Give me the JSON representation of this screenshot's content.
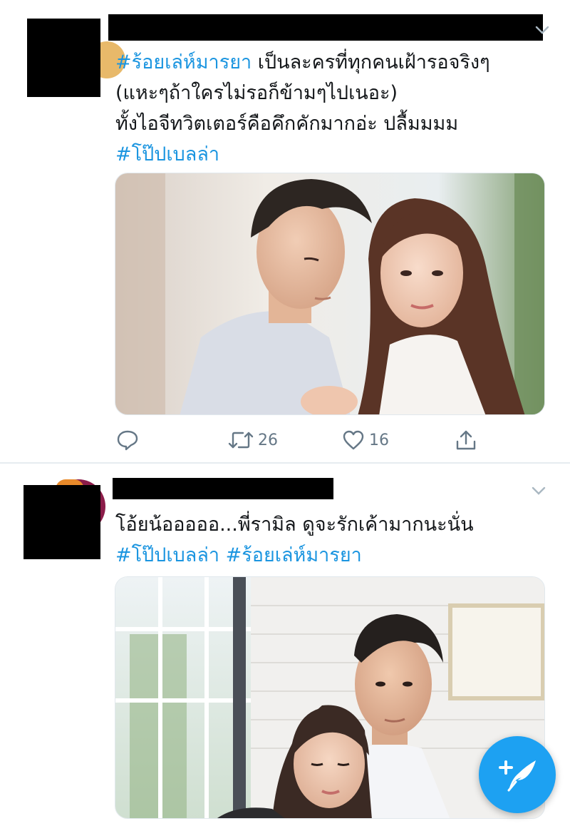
{
  "tweets": [
    {
      "text_lines": [
        [
          {
            "t": "#ร้อยเล่ห์มารยา",
            "tag": true
          },
          {
            "t": " เป็นละครที่ทุกคนเฝ้ารอจริงๆ",
            "tag": false
          }
        ],
        [
          {
            "t": "(แหะๆถ้าใครไม่รอก็ข้ามๆไปเนอะ)",
            "tag": false
          }
        ],
        [
          {
            "t": "ทั้งไอจีทวิตเตอร์คือคึกคักมากอ่ะ ปลื้มมมม",
            "tag": false
          }
        ],
        [
          {
            "t": "#โป๊ปเบลล่า",
            "tag": true
          }
        ]
      ],
      "actions": {
        "reply_count": "",
        "retweet_count": "26",
        "like_count": "16"
      }
    },
    {
      "text_lines": [
        [
          {
            "t": "โอ้ยน้อออออ...พี่รามิล ดูจะรักเค้ามากนะนั่น",
            "tag": false
          }
        ],
        [
          {
            "t": "#โป๊ปเบลล่า",
            "tag": true
          },
          {
            "t": " ",
            "tag": false
          },
          {
            "t": "#ร้อยเล่ห์มารยา",
            "tag": true
          }
        ]
      ]
    }
  ],
  "icons": {
    "reply": "comment-bubble-icon",
    "retweet": "retweet-icon",
    "like": "heart-icon",
    "share": "share-icon",
    "compose": "compose-tweet-icon",
    "menu": "chevron-down-icon"
  },
  "colors": {
    "hashtag": "#1b95e0",
    "action_gray": "#657786",
    "fab_blue": "#1da1f2",
    "divider": "#e6ecf0"
  }
}
